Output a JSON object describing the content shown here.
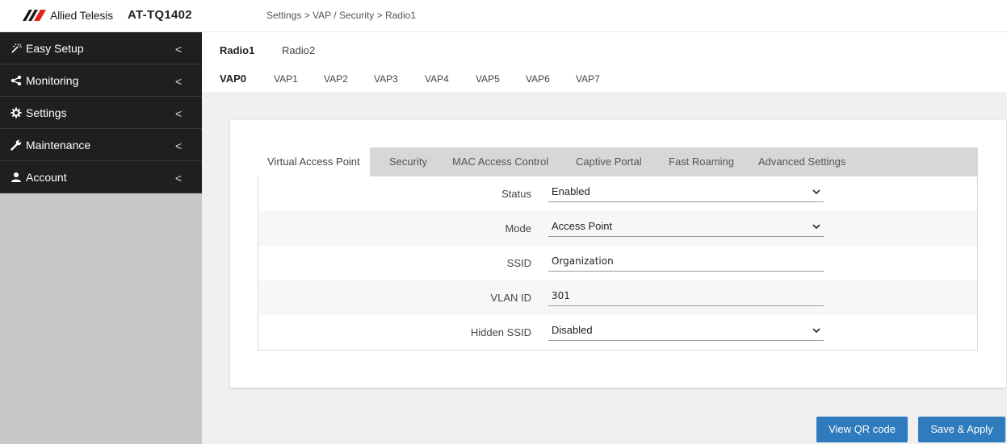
{
  "header": {
    "brand": "Allied Telesis",
    "model": "AT-TQ1402",
    "breadcrumb": "Settings > VAP / Security > Radio1"
  },
  "sidebar": {
    "items": [
      {
        "label": "Easy Setup",
        "icon": "magic-wand-icon"
      },
      {
        "label": "Monitoring",
        "icon": "share-icon"
      },
      {
        "label": "Settings",
        "icon": "gear-icon"
      },
      {
        "label": "Maintenance",
        "icon": "wrench-icon"
      },
      {
        "label": "Account",
        "icon": "user-icon"
      }
    ],
    "chevron": "<"
  },
  "radio_tabs": [
    "Radio1",
    "Radio2"
  ],
  "vap_tabs": [
    "VAP0",
    "VAP1",
    "VAP2",
    "VAP3",
    "VAP4",
    "VAP5",
    "VAP6",
    "VAP7"
  ],
  "inner_tabs": [
    "Virtual Access Point",
    "Security",
    "MAC Access Control",
    "Captive Portal",
    "Fast Roaming",
    "Advanced Settings"
  ],
  "form": {
    "status": {
      "label": "Status",
      "value": "Enabled"
    },
    "mode": {
      "label": "Mode",
      "value": "Access Point"
    },
    "ssid": {
      "label": "SSID",
      "value": "Organization"
    },
    "vlan": {
      "label": "VLAN ID",
      "value": "301"
    },
    "hidden": {
      "label": "Hidden SSID",
      "value": "Disabled"
    }
  },
  "buttons": {
    "qr": "View QR code",
    "save": "Save & Apply"
  },
  "colors": {
    "accent": "#2e7bbd",
    "sidebar_bg": "#1f1f1f",
    "logo_red": "#e2231a"
  }
}
